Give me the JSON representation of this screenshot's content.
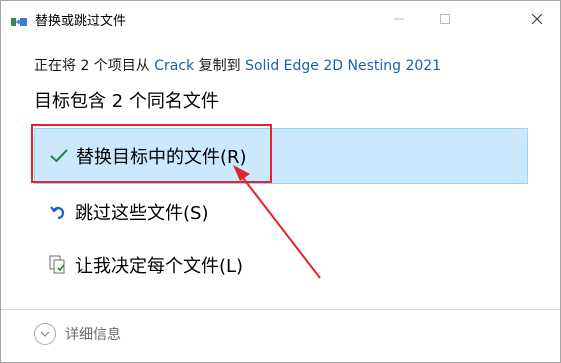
{
  "window": {
    "title": "替换或跳过文件",
    "buttons": {
      "minimize": "minimize-icon",
      "maximize": "maximize-icon",
      "close": "close-icon"
    }
  },
  "copy_info": {
    "prefix": "正在将 2 个项目从 ",
    "source": "Crack",
    "middle": " 复制到 ",
    "destination": "Solid Edge 2D Nesting 2021"
  },
  "heading": "目标包含 2 个同名文件",
  "options": [
    {
      "icon": "checkmark-icon",
      "label": "替换目标中的文件(R)",
      "selected": true
    },
    {
      "icon": "skip-icon",
      "label": "跳过这些文件(S)",
      "selected": false
    },
    {
      "icon": "decide-files-icon",
      "label": "让我决定每个文件(L)",
      "selected": false
    }
  ],
  "footer": {
    "details_label": "详细信息",
    "icon": "chevron-down-icon"
  },
  "colors": {
    "selection": "#cce8ff",
    "link": "#1a5fb4",
    "highlight_box": "#e0252b"
  }
}
